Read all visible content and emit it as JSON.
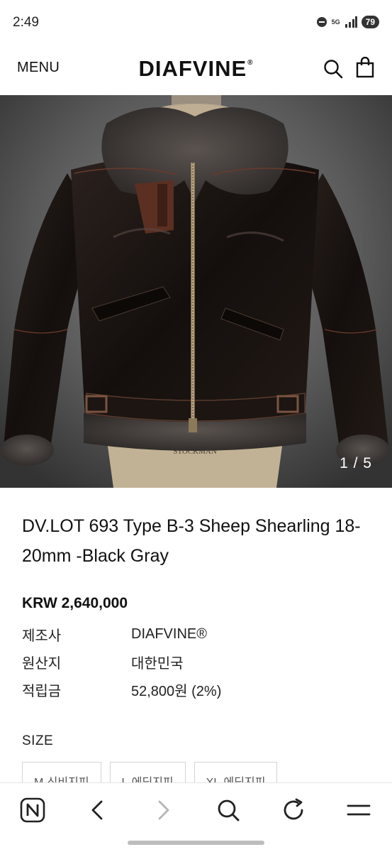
{
  "status_bar": {
    "time": "2:49",
    "network": "5G",
    "battery": "79"
  },
  "header": {
    "menu_label": "MENU",
    "brand": "DIAFVINE",
    "brand_mark": "®"
  },
  "gallery": {
    "counter": "1 / 5",
    "current_index": 1,
    "total": 5
  },
  "product": {
    "title": "DV.LOT 693 Type B-3 Sheep Shearling 18-20mm -Black Gray",
    "price": "KRW 2,640,000",
    "info": [
      {
        "label": "제조사",
        "value": "DIAFVINE®"
      },
      {
        "label": "원산지",
        "value": "대한민국"
      },
      {
        "label": "적립금",
        "value": "52,800원 (2%)"
      }
    ]
  },
  "size": {
    "label": "SIZE",
    "options": [
      "M-신비지피",
      "L-에딩지피",
      "XL-에딩지피"
    ]
  },
  "bottom_nav": {
    "icons": [
      "naver-n-icon",
      "back-arrow-icon",
      "forward-arrow-icon",
      "search-icon",
      "refresh-icon",
      "menu-icon"
    ]
  },
  "colors": {
    "accent": "#111111",
    "image_background": "#5e5e5e",
    "jacket": "#1a1411",
    "shearling": "#3e3936"
  }
}
